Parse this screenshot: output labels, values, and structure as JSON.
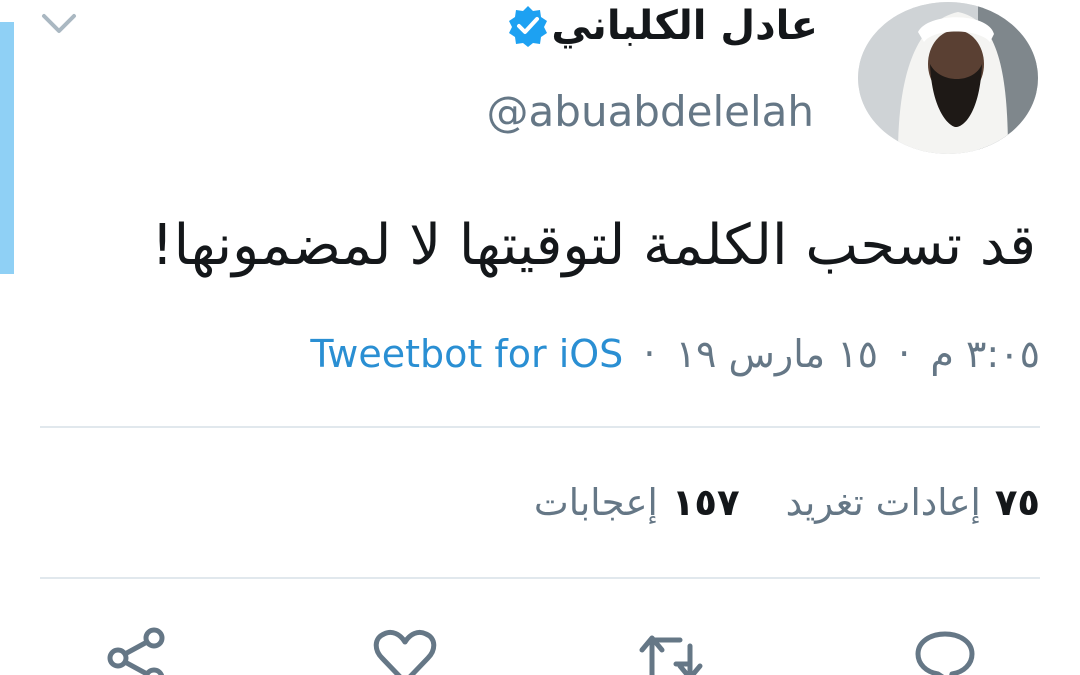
{
  "tweet": {
    "display_name": "عادل الكلباني",
    "handle": "@abuabdelelah",
    "verified": true,
    "text": "قد تسحب الكلمة لتوقيتها لا لمضمونها!",
    "time": "٣:٠٥ م",
    "date": "١٥ مارس ١٩",
    "separator": "·",
    "source": "Tweetbot for iOS"
  },
  "stats": {
    "retweets_count": "٧٥",
    "retweets_label": "إعادات تغريد",
    "likes_count": "١٥٧",
    "likes_label": "إعجابات"
  },
  "icons": {
    "verified": "verified-badge-icon",
    "caret": "chevron-down-icon",
    "reply": "reply-icon",
    "retweet": "retweet-icon",
    "like": "heart-icon",
    "share": "share-icon"
  },
  "colors": {
    "accent": "#1da1f2",
    "link": "#2a8fd3",
    "muted": "#657786",
    "thread_line": "#8fd0f5"
  }
}
